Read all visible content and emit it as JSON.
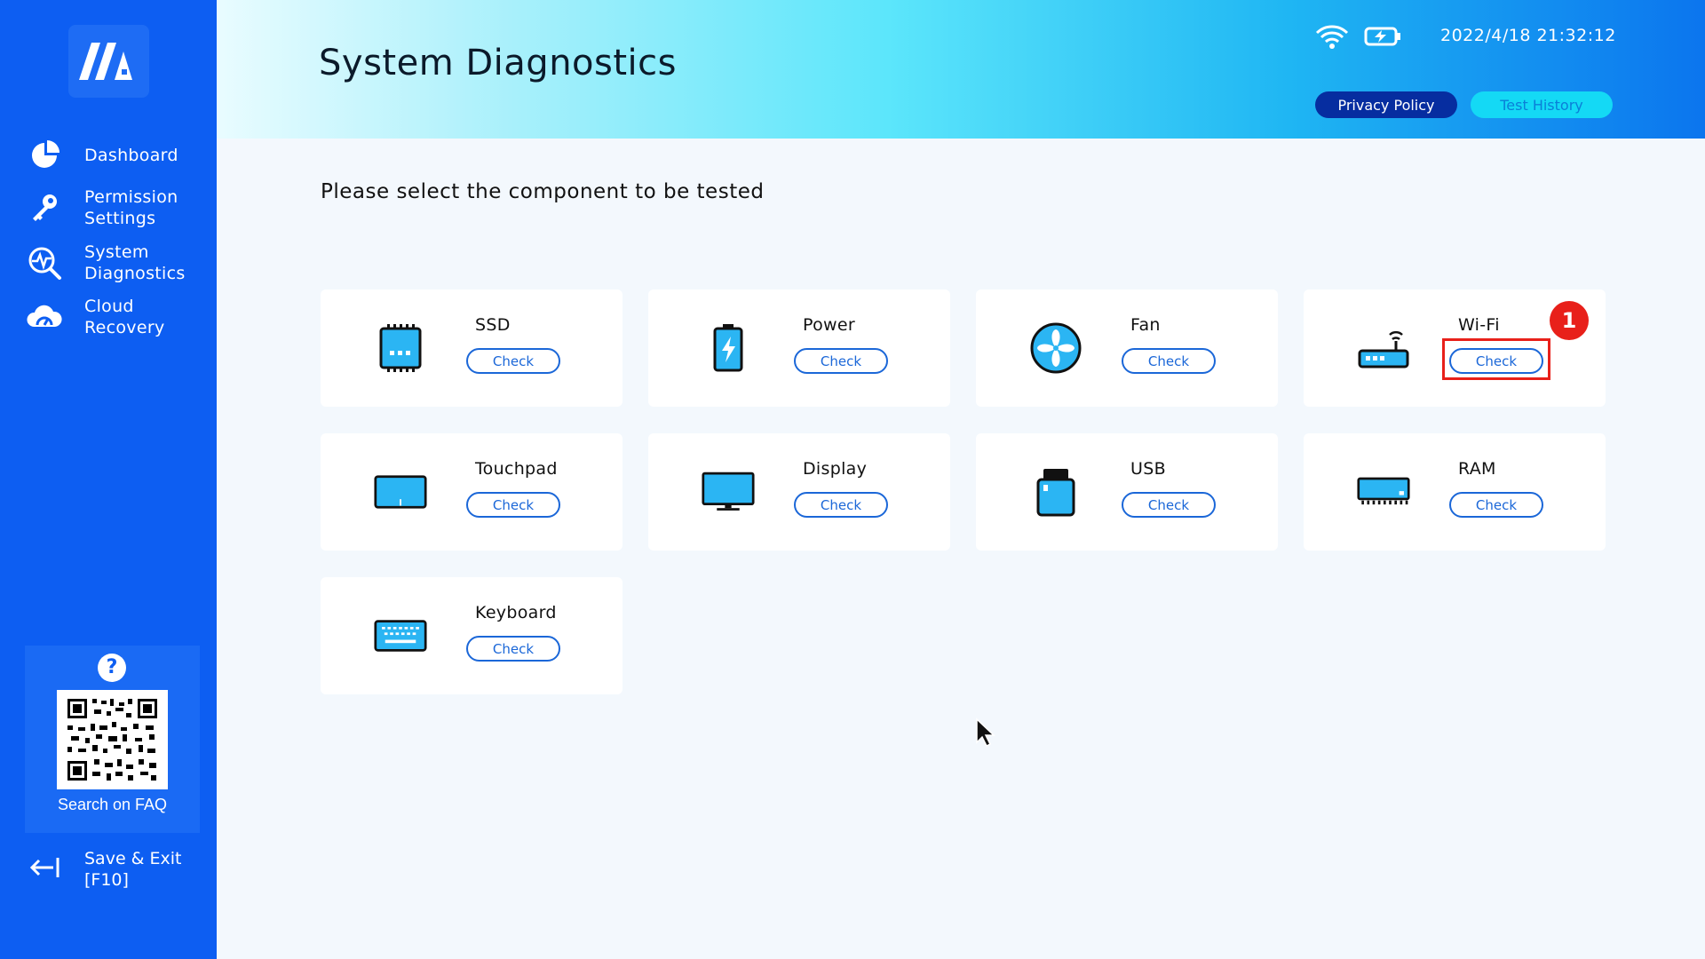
{
  "sidebar": {
    "items": [
      {
        "label": "Dashboard",
        "icon": "pie-chart-icon"
      },
      {
        "label": "Permission\nSettings",
        "icon": "key-icon"
      },
      {
        "label": "System\nDiagnostics",
        "icon": "diagnostics-icon"
      },
      {
        "label": "Cloud\nRecovery",
        "icon": "cloud-icon"
      }
    ],
    "faq": {
      "help_symbol": "?",
      "label": "Search on FAQ"
    },
    "save_exit": {
      "label": "Save & Exit\n[F10]"
    }
  },
  "header": {
    "title": "System Diagnostics",
    "datetime": "2022/4/18 21:32:12",
    "privacy_button": "Privacy Policy",
    "history_button": "Test History"
  },
  "main": {
    "prompt": "Please select the component to be tested",
    "components": [
      {
        "name": "SSD",
        "button": "Check",
        "icon": "ssd-icon"
      },
      {
        "name": "Power",
        "button": "Check",
        "icon": "battery-icon"
      },
      {
        "name": "Fan",
        "button": "Check",
        "icon": "fan-icon"
      },
      {
        "name": "Wi-Fi",
        "button": "Check",
        "icon": "router-icon"
      },
      {
        "name": "Touchpad",
        "button": "Check",
        "icon": "touchpad-icon"
      },
      {
        "name": "Display",
        "button": "Check",
        "icon": "monitor-icon"
      },
      {
        "name": "USB",
        "button": "Check",
        "icon": "usb-icon"
      },
      {
        "name": "RAM",
        "button": "Check",
        "icon": "ram-icon"
      },
      {
        "name": "Keyboard",
        "button": "Check",
        "icon": "keyboard-icon"
      }
    ],
    "step_badge": "1"
  },
  "colors": {
    "sidebar": "#0d5ef2",
    "accent": "#1b67d8",
    "icon_fill": "#2bb5f3",
    "highlight": "#e8201a"
  }
}
